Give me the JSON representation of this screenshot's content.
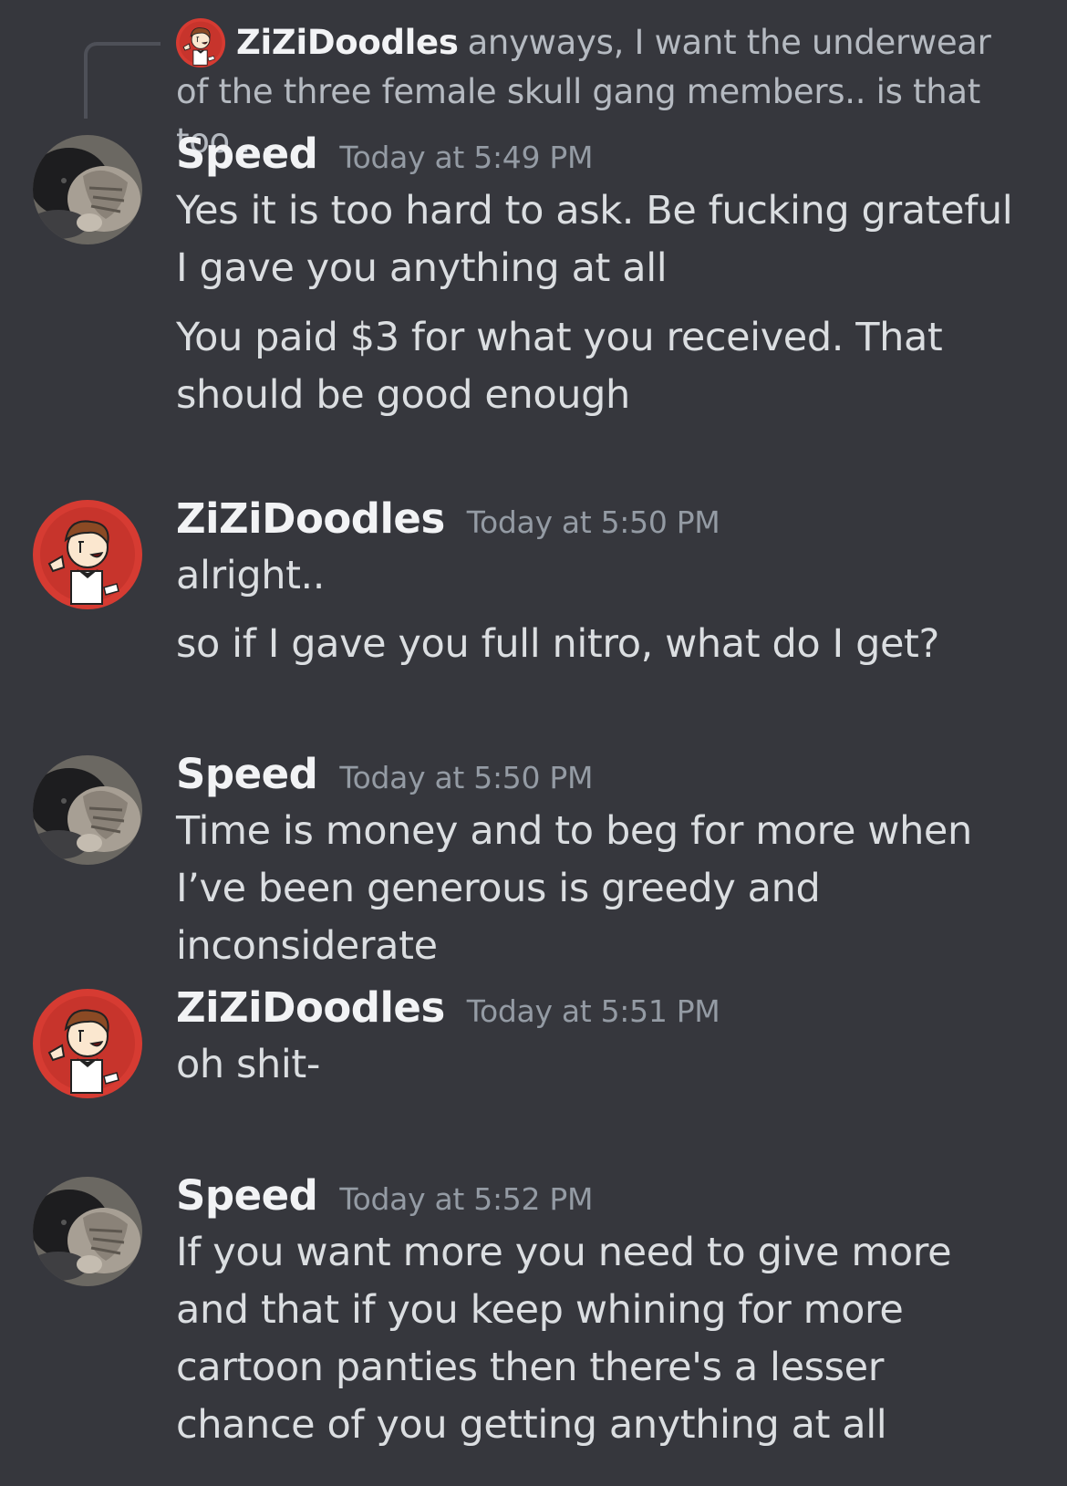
{
  "reply": {
    "author": "ZiZiDoodles",
    "excerpt": "anyways, I want the underwear of the three female skull gang members.. is that too ..."
  },
  "messages": [
    {
      "author": "Speed",
      "time": "Today at 5:49 PM",
      "lines": [
        "Yes it is too hard to ask. Be fucking grateful I gave you anything at all",
        "You paid $3 for what you received. That should be good enough"
      ]
    },
    {
      "author": "ZiZiDoodles",
      "time": "Today at 5:50 PM",
      "lines": [
        "alright..",
        "so if I gave you full nitro, what do I get?"
      ]
    },
    {
      "author": "Speed",
      "time": "Today at 5:50 PM",
      "lines": [
        "Time is money and to beg for more when I’ve been generous is greedy and inconsiderate"
      ]
    },
    {
      "author": "ZiZiDoodles",
      "time": "Today at 5:51 PM",
      "lines": [
        "oh shit-"
      ]
    },
    {
      "author": "Speed",
      "time": "Today at 5:52 PM",
      "lines": [
        "If you want more you need to give more and that if you keep whining for more cartoon panties then there's a lesser chance of you getting anything at all"
      ]
    }
  ],
  "colors": {
    "background": "#36373d",
    "username": "#f2f3f5",
    "timestamp": "#949ba4",
    "message_text": "#dbdee1",
    "reply_text": "#b5bac1",
    "reply_line": "#4e5058"
  },
  "icons": {
    "speed_avatar": "cat-photo-avatar",
    "zizi_avatar": "cartoon-character-avatar"
  }
}
